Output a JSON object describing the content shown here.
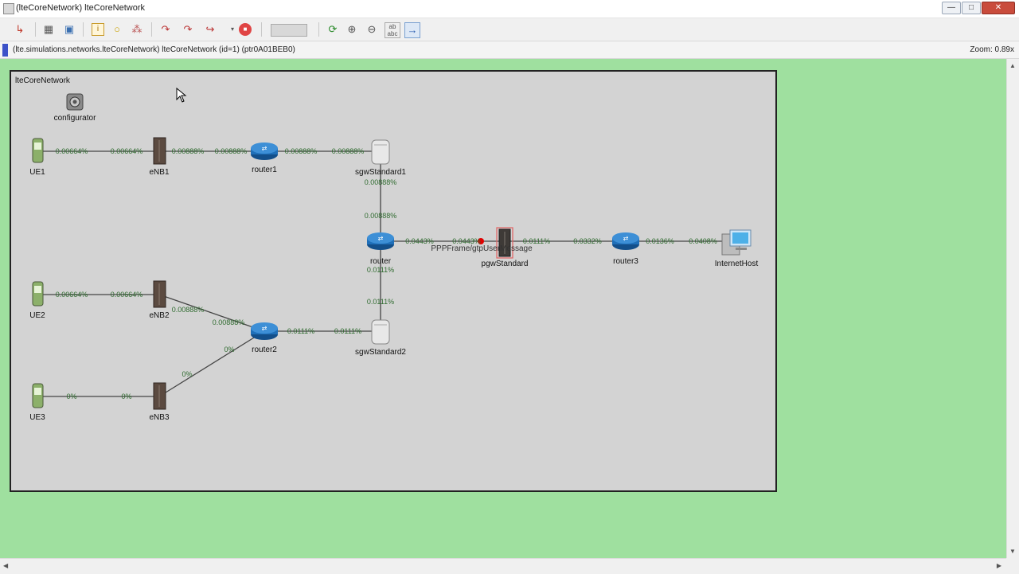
{
  "window": {
    "title": "(lteCoreNetwork) lteCoreNetwork",
    "controls": [
      "—",
      "□",
      "✕"
    ]
  },
  "toolbar": {
    "icons": [
      "run-step-icon",
      "grid-icon",
      "inspect-icon",
      "info-icon",
      "circle-icon",
      "tree-icon",
      "step-icon",
      "run-icon",
      "fast-run-icon",
      "stop-icon",
      "speed-slider-icon",
      "refresh-icon",
      "zoom-in-icon",
      "zoom-out-icon",
      "label-icon",
      "arrow-icon"
    ]
  },
  "pathbar": {
    "path": "(lte.simulations.networks.lteCoreNetwork) lteCoreNetwork  (id=1)  (ptr0A01BEB0)",
    "zoom": "Zoom: 0.89x"
  },
  "network": {
    "name": "lteCoreNetwork",
    "colors": {
      "canvas": "#9fe09f",
      "network_bg": "#d3d3d3",
      "link_label": "#2f6b2f",
      "router": "#1f6fb8",
      "message_dot": "#e00000"
    },
    "nodes": {
      "configurator": "configurator",
      "ue1": "UE1",
      "ue2": "UE2",
      "ue3": "UE3",
      "enb1": "eNB1",
      "enb2": "eNB2",
      "enb3": "eNB3",
      "router1": "router1",
      "router": "router",
      "router2": "router2",
      "router3": "router3",
      "sgw1": "sgwStandard1",
      "sgw2": "sgwStandard2",
      "pgw": "pgwStandard",
      "internet": "InternetHost"
    },
    "link_labels": {
      "ue1_a": "0.00664%",
      "ue1_b": "0.00664%",
      "enb1_a": "0.00888%",
      "enb1_b": "0.00888%",
      "r1_a": "0.00888%",
      "r1_b": "0.00888%",
      "sgw1_a": "0.00888%",
      "sgw1_b": "0.00888%",
      "r_pgw_a": "0.0443%",
      "r_pgw_b": "0.0443%",
      "pgw_r3_a": "0.0111%",
      "pgw_r3_b": "0.0332%",
      "r3_inet_a": "0.0136%",
      "r3_inet_b": "0.0408%",
      "r_sgw2_a": "0.0111%",
      "r_sgw2_b": "0.0111%",
      "ue2_a": "0.00664%",
      "ue2_b": "0.00664%",
      "enb2_a": "0.00888%",
      "enb2_b": "0.00888%",
      "r2_sgw2_a": "0.0111%",
      "r2_sgw2_b": "0.0111%",
      "ue3_a": "0%",
      "ue3_b": "0%",
      "enb3_a": "0%",
      "enb3_b": "0%"
    },
    "message": "PPPFrame/gtpUserMessage"
  }
}
